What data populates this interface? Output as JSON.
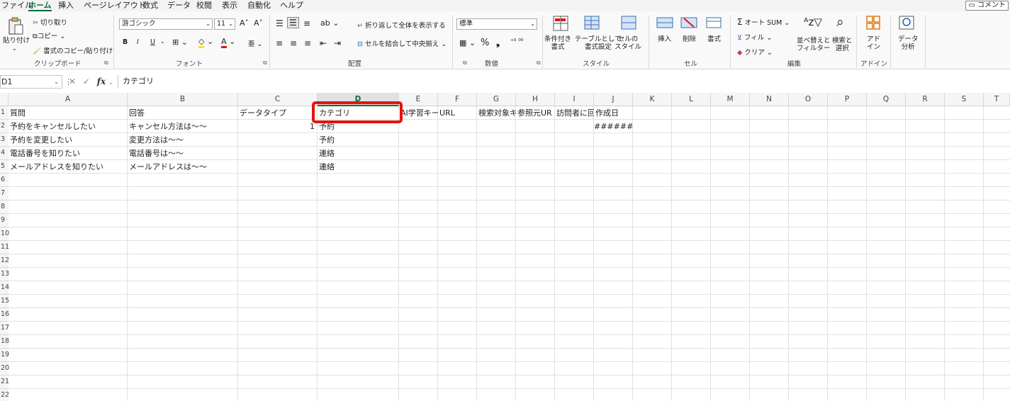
{
  "menu": {
    "items": [
      "ファイル",
      "ホーム",
      "挿入",
      "ページレイアウト",
      "数式",
      "データ",
      "校閲",
      "表示",
      "自動化",
      "ヘルプ"
    ],
    "active": "ホーム",
    "comment_button": "コメント"
  },
  "ribbon": {
    "clipboard": {
      "paste": "貼り付け",
      "cut": "切り取り",
      "copy": "コピー",
      "format_painter": "書式のコピー/貼り付け",
      "label": "クリップボード"
    },
    "font": {
      "font_name": "游ゴシック",
      "font_size": "11",
      "bold": "B",
      "italic": "I",
      "underline": "U",
      "label": "フォント"
    },
    "alignment": {
      "wrap_text": "折り返して全体を表示する",
      "merge_center": "セルを結合して中央揃え",
      "label": "配置"
    },
    "number": {
      "format": "標準",
      "label": "数値"
    },
    "styles": {
      "conditional": "条件付き\n書式",
      "as_table": "テーブルとして\n書式設定",
      "cell_styles": "セルの\nスタイル",
      "label": "スタイル"
    },
    "cells": {
      "insert": "挿入",
      "delete": "削除",
      "format": "書式",
      "label": "セル"
    },
    "editing": {
      "autosum": "オート SUM",
      "fill": "フィル",
      "clear": "クリア",
      "sort_filter": "並べ替えと\nフィルター",
      "find_select": "検索と\n選択",
      "label": "編集"
    },
    "addins": {
      "addin": "アド\nイン",
      "label": "アドイン"
    },
    "analysis": {
      "data_analysis": "データ\n分析"
    }
  },
  "formula_bar": {
    "name_box": "D1",
    "formula": "カテゴリ",
    "fx": "fx"
  },
  "sheet": {
    "columns": [
      "A",
      "B",
      "C",
      "D",
      "E",
      "F",
      "G",
      "H",
      "I",
      "J",
      "K",
      "L",
      "M",
      "N",
      "O",
      "P",
      "Q",
      "R",
      "S",
      "T"
    ],
    "selected_column": "D",
    "row_numbers": [
      "1",
      "2",
      "3",
      "4",
      "5",
      "6",
      "7",
      "8",
      "9",
      "10",
      "11",
      "12",
      "13",
      "14",
      "15",
      "16",
      "17",
      "18",
      "19",
      "20",
      "21",
      "22"
    ],
    "header_row": [
      "質問",
      "回答",
      "データタイプ",
      "カテゴリ",
      "AI学習キー",
      "URL",
      "検索対象キ",
      "参照元UR",
      "訪問者に回",
      "作成日"
    ],
    "rows": [
      [
        "予約をキャンセルしたい",
        "キャンセル方法は～～",
        "1",
        "予約",
        "",
        "",
        "",
        "",
        "",
        "#######"
      ],
      [
        "予約を変更したい",
        "変更方法は～～",
        "",
        "予約",
        "",
        "",
        "",
        "",
        "",
        ""
      ],
      [
        "電話番号を知りたい",
        "電話番号は～～",
        "",
        "連絡",
        "",
        "",
        "",
        "",
        "",
        ""
      ],
      [
        "メールアドレスを知りたい",
        "メールアドレスは～～",
        "",
        "連絡",
        "",
        "",
        "",
        "",
        "",
        ""
      ]
    ]
  },
  "colors": {
    "accent": "#0f6b3a",
    "highlight": "#e3140e"
  }
}
